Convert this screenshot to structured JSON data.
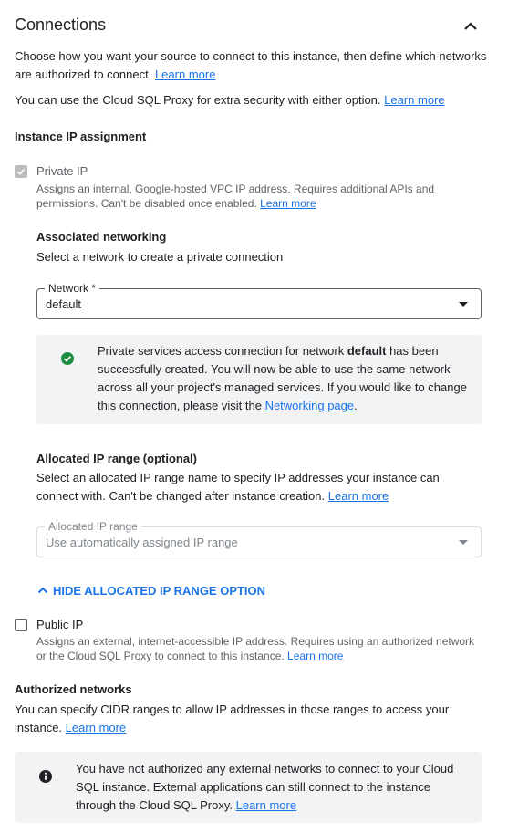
{
  "header": {
    "title": "Connections"
  },
  "intro": {
    "text": "Choose how you want your source to connect to this instance, then define which networks are authorized to connect.",
    "learn_more": "Learn more"
  },
  "proxy": {
    "text": "You can use the Cloud SQL Proxy for extra security with either option.",
    "learn_more": "Learn more"
  },
  "ip_assignment": {
    "heading": "Instance IP assignment"
  },
  "private_ip": {
    "label": "Private IP",
    "checked": true,
    "disabled": true,
    "description": "Assigns an internal, Google-hosted VPC IP address. Requires additional APIs and permissions. Can't be disabled once enabled.",
    "learn_more": "Learn more"
  },
  "associated_networking": {
    "heading": "Associated networking",
    "text": "Select a network to create a private connection",
    "network_label": "Network *",
    "network_value": "default"
  },
  "psa_notice": {
    "text_before": "Private services access connection for network ",
    "network": "default",
    "text_after": " has been successfully created. You will now be able to use the same network across all your project's managed services. If you would like to change this connection, please visit the ",
    "link": "Networking page",
    "end": "."
  },
  "allocated_range": {
    "heading": "Allocated IP range (optional)",
    "text": "Select an allocated IP range name to specify IP addresses your instance can connect with. Can't be changed after instance creation.",
    "learn_more": "Learn more",
    "field_label": "Allocated IP range",
    "field_value": "Use automatically assigned IP range",
    "toggle": "HIDE ALLOCATED IP RANGE OPTION"
  },
  "public_ip": {
    "label": "Public IP",
    "checked": false,
    "description": "Assigns an external, internet-accessible IP address. Requires using an authorized network or the Cloud SQL Proxy to connect to this instance.",
    "learn_more": "Learn more"
  },
  "authorized_networks": {
    "heading": "Authorized networks",
    "text": "You can specify CIDR ranges to allow IP addresses in those ranges to access your instance.",
    "learn_more": "Learn more",
    "notice": "You have not authorized any external networks to connect to your Cloud SQL instance. External applications can still connect to the instance through the Cloud SQL Proxy.",
    "notice_link": "Learn more"
  },
  "colors": {
    "accent": "#1a73e8",
    "success": "#1e8e3e",
    "notice_bg": "#f1f3f4",
    "text": "#202124",
    "muted": "#5f6368"
  },
  "icons": {
    "collapse": "chevron-up-icon",
    "success": "check-circle-icon",
    "info": "info-icon",
    "dropdown": "caret-down-icon"
  }
}
